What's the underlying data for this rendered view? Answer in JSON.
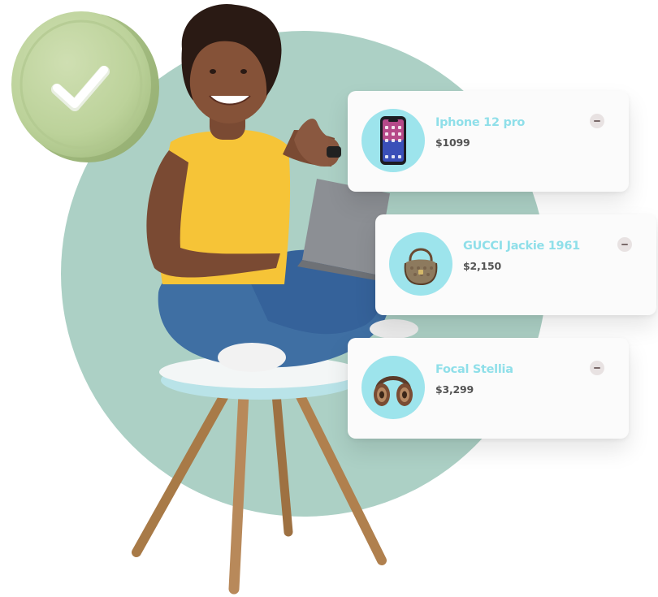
{
  "products": [
    {
      "name": "Iphone 12 pro",
      "price": "$1099",
      "icon": "smartphone-icon"
    },
    {
      "name": "GUCCI Jackie 1961",
      "price": "$2,150",
      "icon": "handbag-icon"
    },
    {
      "name": "Focal Stellia",
      "price": "$3,299",
      "icon": "headphones-icon"
    }
  ],
  "colors": {
    "background_circle": "#acd0c5",
    "badge": "#c3d6a2",
    "thumb_circle": "#9de4ec",
    "product_name": "#8fdfe9",
    "price": "#545454",
    "shirt": "#f6c437",
    "jeans": "#3f6fa3"
  },
  "icons": {
    "badge": "checkmark-icon",
    "remove": "minus-icon"
  }
}
